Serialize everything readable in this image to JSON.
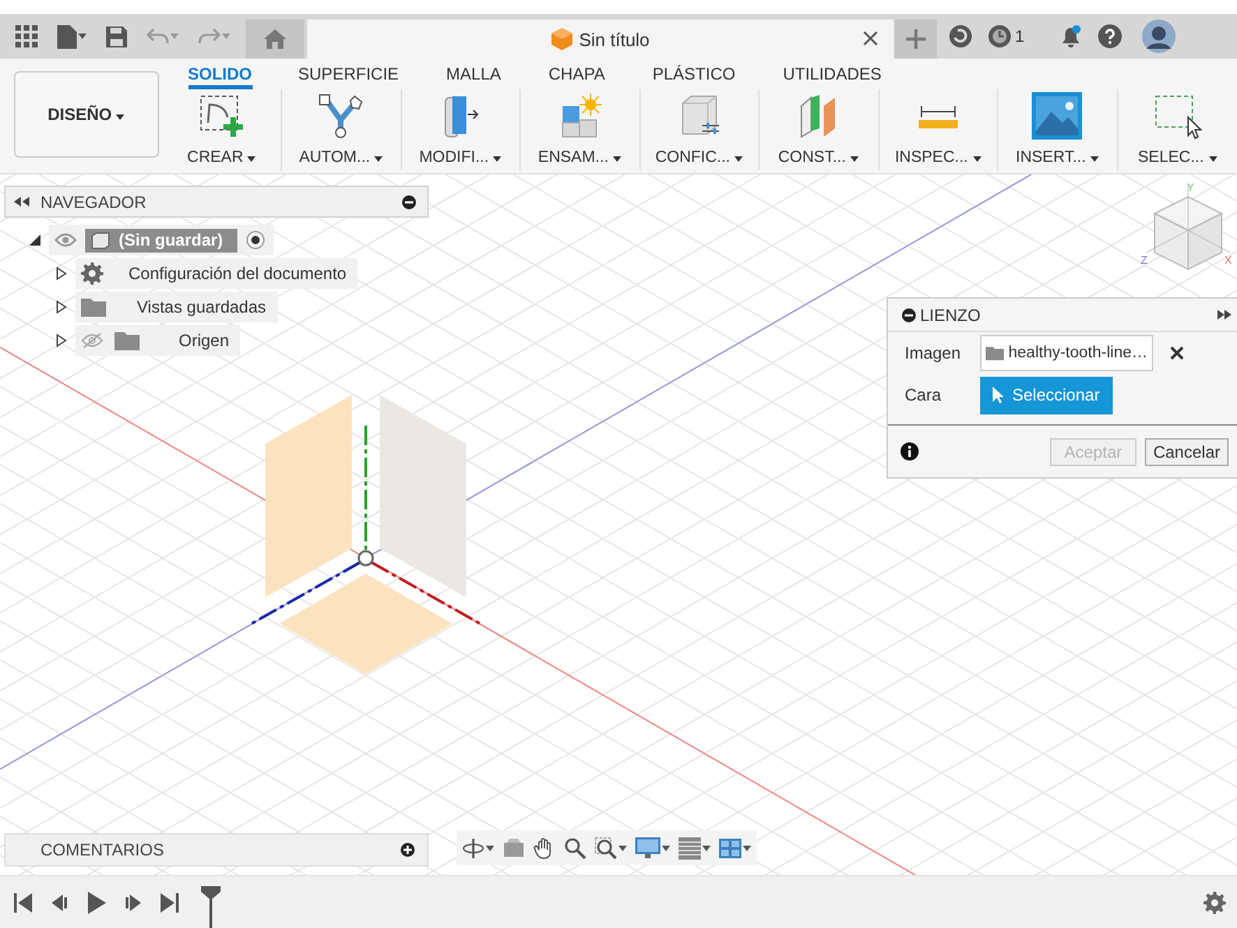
{
  "title_bar": {
    "document_title": "Sin título",
    "jobs_count": "1"
  },
  "workspace": {
    "label": "DISEÑO"
  },
  "ribbon_tabs": [
    {
      "label": "SOLIDO",
      "selected": true
    },
    {
      "label": "SUPERFICIE",
      "selected": false
    },
    {
      "label": "MALLA",
      "selected": false
    },
    {
      "label": "CHAPA",
      "selected": false
    },
    {
      "label": "PLÁSTICO",
      "selected": false
    },
    {
      "label": "UTILIDADES",
      "selected": false
    }
  ],
  "tool_groups": [
    {
      "label": "CREAR",
      "kind": "sketch"
    },
    {
      "label": "AUTOM...",
      "kind": "automate"
    },
    {
      "label": "MODIFI...",
      "kind": "modify"
    },
    {
      "label": "ENSAM...",
      "kind": "assemble"
    },
    {
      "label": "CONFIC...",
      "kind": "configure"
    },
    {
      "label": "CONST...",
      "kind": "construct"
    },
    {
      "label": "INSPEC...",
      "kind": "inspect"
    },
    {
      "label": "INSERT...",
      "kind": "insert"
    },
    {
      "label": "SELEC...",
      "kind": "select"
    }
  ],
  "navigator": {
    "title": "NAVEGADOR",
    "root": {
      "label": "(Sin guardar)",
      "expanded": true,
      "visible": true,
      "active": true,
      "children": [
        {
          "label": "Configuración del documento",
          "kind": "settings",
          "expanded": false,
          "visible": true
        },
        {
          "label": "Vistas guardadas",
          "kind": "folder",
          "expanded": false,
          "visible": true
        },
        {
          "label": "Origen",
          "kind": "folder",
          "expanded": false,
          "visible": false
        }
      ]
    }
  },
  "viewcube": {
    "axis_labels": [
      "Y",
      "Z",
      "X"
    ]
  },
  "canvas_dialog": {
    "title": "LIENZO",
    "fields": [
      {
        "label": "Imagen",
        "kind": "file",
        "value": "healthy-tooth-line…"
      },
      {
        "label": "Cara",
        "kind": "pick",
        "value": "Seleccionar"
      }
    ],
    "buttons": [
      {
        "label": "Aceptar",
        "disabled": true
      },
      {
        "label": "Cancelar",
        "disabled": false
      }
    ]
  },
  "comments": {
    "title": "COMENTARIOS"
  }
}
